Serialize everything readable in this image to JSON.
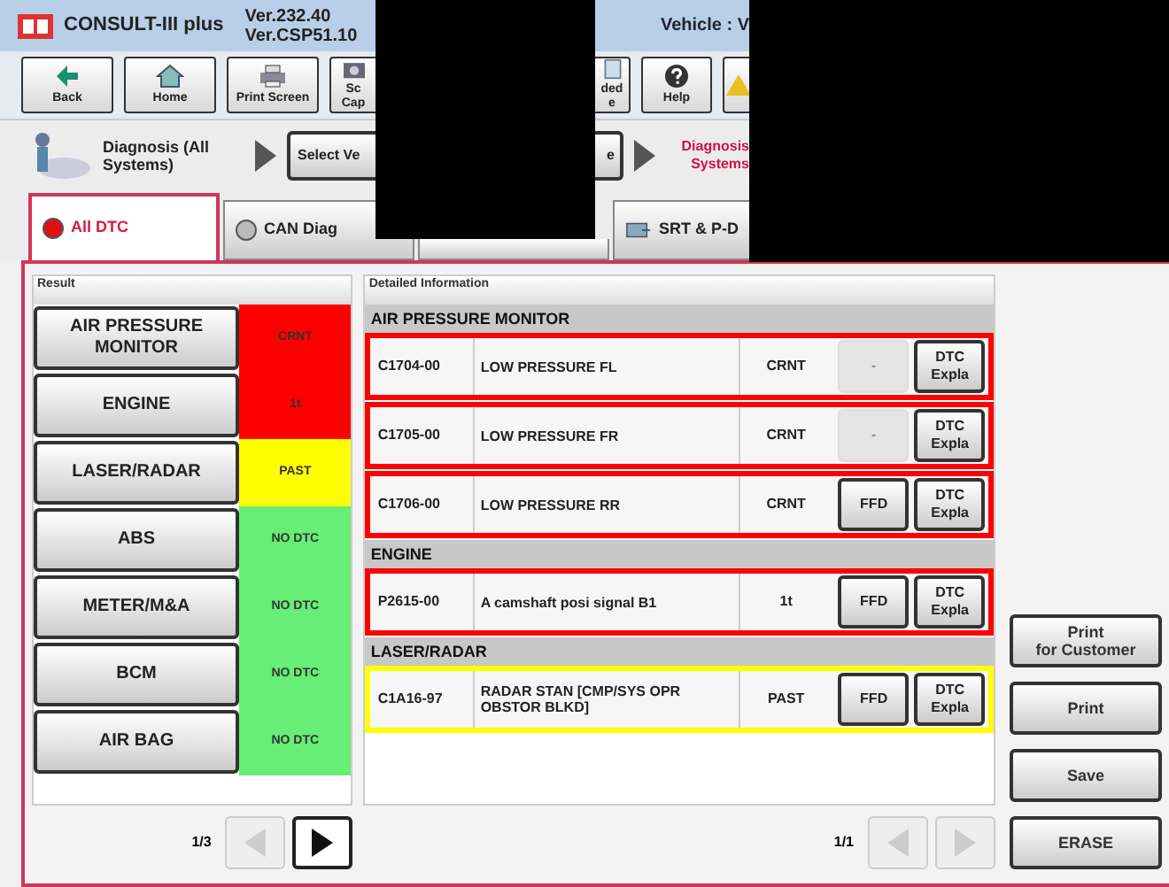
{
  "title_bar": {
    "app_name": "CONSULT-III plus",
    "versions": [
      "Ver.232.40",
      "Ver.CSP51.10"
    ],
    "vehicle": "Vehicle : V"
  },
  "toolbar": [
    {
      "kind": "back",
      "lines": [
        "Back"
      ]
    },
    {
      "kind": "home",
      "lines": [
        "Home"
      ]
    },
    {
      "kind": "printer",
      "lines": [
        "Print Screen"
      ]
    },
    {
      "kind": "camera",
      "lines": [
        "Sc",
        "Cap"
      ]
    },
    {
      "kind": "recorded",
      "lines": [
        "ded",
        "e"
      ]
    },
    {
      "kind": "help",
      "lines": [
        "Help"
      ]
    },
    {
      "kind": "warning"
    }
  ],
  "breadcrumb": {
    "start": "Diagnosis (All Systems)",
    "step": "Select Ve",
    "step_tail": "e",
    "current": "Diagnosis Systems"
  },
  "tabs": [
    {
      "label": "All DTC",
      "kind": "dot",
      "selected": true
    },
    {
      "label": "CAN Diag",
      "kind": "dot",
      "selected": false
    },
    {
      "kind": "blank",
      "selected": false
    },
    {
      "label": "SRT & P-D",
      "kind": "icon",
      "selected": false
    }
  ],
  "result": {
    "header": "Result",
    "systems": [
      {
        "name": "AIR PRESSURE MONITOR",
        "status": "CRNT",
        "color": "#ff0000"
      },
      {
        "name": "ENGINE",
        "status": "1t",
        "color": "#ff0000"
      },
      {
        "name": "LASER/RADAR",
        "status": "PAST",
        "color": "#ffff00"
      },
      {
        "name": "ABS",
        "status": "NO DTC",
        "color": "#66ee77"
      },
      {
        "name": "METER/M&A",
        "status": "NO DTC",
        "color": "#66ee77"
      },
      {
        "name": "BCM",
        "status": "NO DTC",
        "color": "#66ee77"
      },
      {
        "name": "AIR BAG",
        "status": "NO DTC",
        "color": "#66ee77"
      }
    ],
    "page": "1/3",
    "prev_disabled": true,
    "next_disabled": false
  },
  "details": {
    "header": "Detailed Information",
    "groups": [
      {
        "name": "AIR PRESSURE MONITOR",
        "rows": [
          {
            "code": "C1704-00",
            "description": "LOW PRESSURE FL",
            "status": "CRNT",
            "ffd": "-",
            "ffd_disabled": true,
            "explain": [
              "DTC",
              "Expla"
            ],
            "color": "#ff0000"
          },
          {
            "code": "C1705-00",
            "description": "LOW PRESSURE FR",
            "status": "CRNT",
            "ffd": "-",
            "ffd_disabled": true,
            "explain": [
              "DTC",
              "Expla"
            ],
            "color": "#ff0000"
          },
          {
            "code": "C1706-00",
            "description": "LOW PRESSURE RR",
            "status": "CRNT",
            "ffd": "FFD",
            "ffd_disabled": false,
            "explain": [
              "DTC",
              "Expla"
            ],
            "color": "#ff0000"
          }
        ]
      },
      {
        "name": "ENGINE",
        "rows": [
          {
            "code": "P2615-00",
            "description": "A camshaft posi signal B1",
            "status": "1t",
            "ffd": "FFD",
            "ffd_disabled": false,
            "explain": [
              "DTC",
              "Expla"
            ],
            "color": "#ff0000"
          }
        ]
      },
      {
        "name": "LASER/RADAR",
        "rows": [
          {
            "code": "C1A16-97",
            "description": "RADAR STAN [CMP/SYS OPR OBSTOR BLKD]",
            "status": "PAST",
            "ffd": "FFD",
            "ffd_disabled": false,
            "explain": [
              "DTC",
              "Expla"
            ],
            "color": "#ffff00"
          }
        ]
      }
    ],
    "page": "1/1",
    "prev_disabled": true,
    "next_disabled": true
  },
  "actions": [
    {
      "lines": [
        "Print",
        "for Customer"
      ]
    },
    {
      "lines": [
        "Print"
      ]
    },
    {
      "lines": [
        "Save"
      ]
    },
    {
      "lines": [
        "ERASE"
      ]
    }
  ]
}
